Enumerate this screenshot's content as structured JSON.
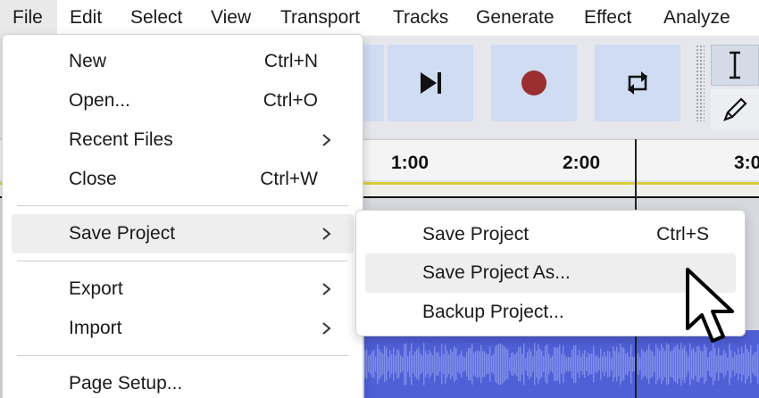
{
  "menubar": {
    "file": "File",
    "edit": "Edit",
    "select": "Select",
    "view": "View",
    "transport": "Transport",
    "tracks": "Tracks",
    "generate": "Generate",
    "effect": "Effect",
    "analyze": "Analyze"
  },
  "toolbar": {
    "buttons": [
      "skip-to-end-icon",
      "record-icon",
      "loop-icon"
    ],
    "tools": [
      "selection-tool-icon",
      "draw-tool-icon"
    ],
    "record_color": "#9b2f2f"
  },
  "timeline": {
    "ticks": [
      "1:00",
      "2:00",
      "3:0"
    ]
  },
  "file_menu": {
    "items": [
      {
        "label": "New",
        "shortcut": "Ctrl+N"
      },
      {
        "label": "Open...",
        "shortcut": "Ctrl+O"
      },
      {
        "label": "Recent Files",
        "shortcut": ""
      },
      {
        "label": "Close",
        "shortcut": "Ctrl+W"
      },
      {
        "label": "Save Project",
        "shortcut": ""
      },
      {
        "label": "Export",
        "shortcut": ""
      },
      {
        "label": "Import",
        "shortcut": ""
      },
      {
        "label": "Page Setup...",
        "shortcut": ""
      }
    ]
  },
  "save_submenu": {
    "items": [
      {
        "label": "Save Project",
        "shortcut": "Ctrl+S"
      },
      {
        "label": "Save Project As...",
        "shortcut": ""
      },
      {
        "label": "Backup Project...",
        "shortcut": ""
      }
    ]
  },
  "colors": {
    "button_bg": "#cfdcf2",
    "waveform": "#4f5fd6",
    "highlight": "#eeeeee"
  }
}
